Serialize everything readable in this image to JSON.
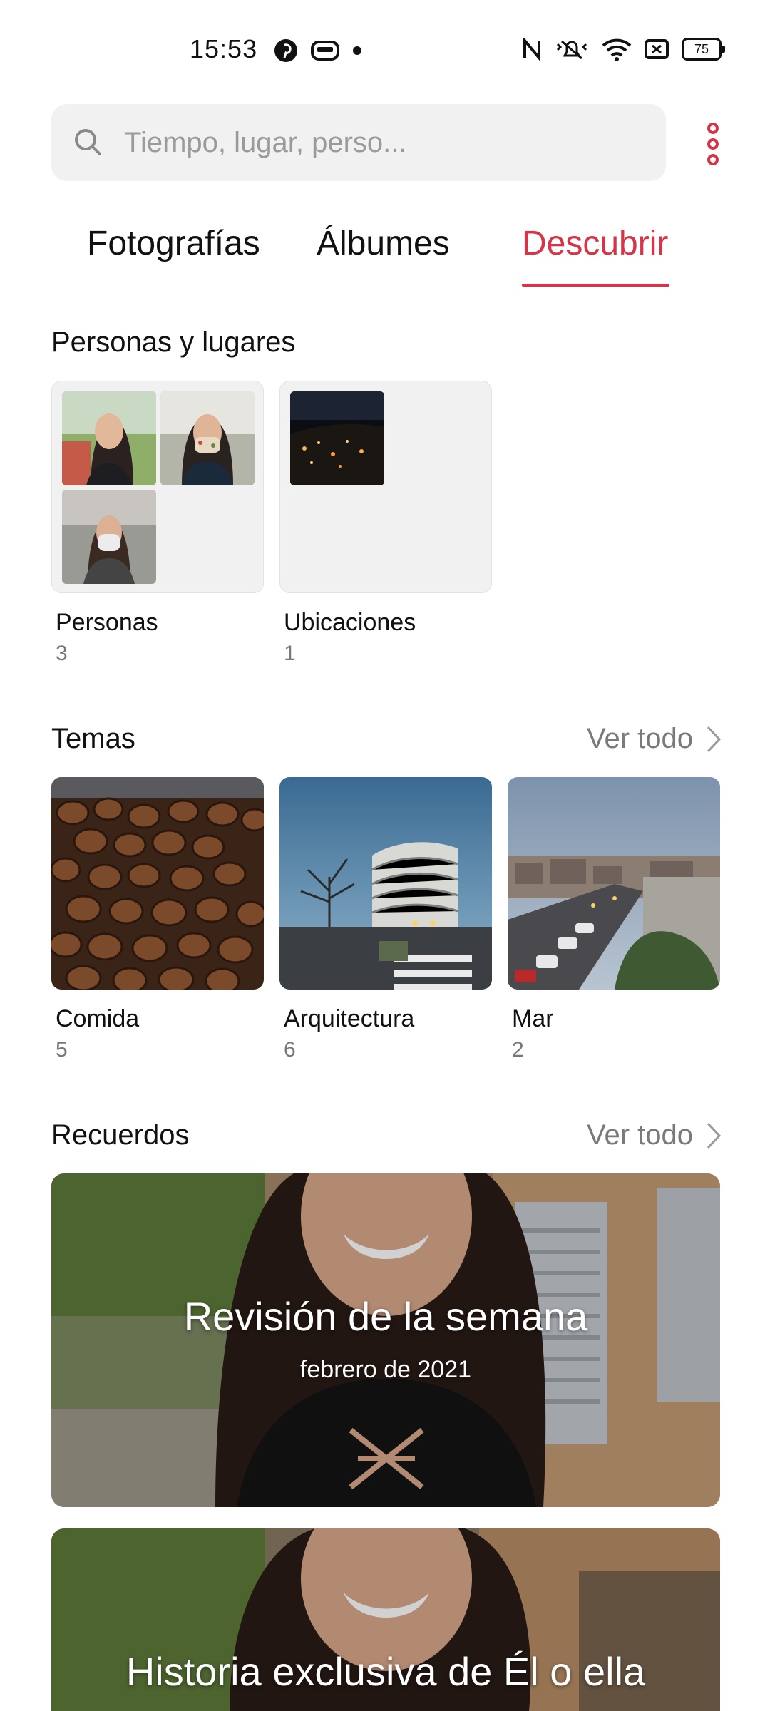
{
  "status_bar": {
    "time": "15:53",
    "battery_level": "75",
    "left_icons": [
      "pinterest-icon",
      "media-icon",
      "notification-dot-icon"
    ],
    "right_icons": [
      "nfc-icon",
      "vibrate-icon",
      "wifi-icon",
      "sim-icon",
      "battery-icon"
    ]
  },
  "search": {
    "placeholder": "Tiempo, lugar, perso..."
  },
  "tabs": [
    {
      "label": "Fotografías",
      "active": false
    },
    {
      "label": "Álbumes",
      "active": false
    },
    {
      "label": "Descubrir",
      "active": true
    }
  ],
  "people_places": {
    "title": "Personas y lugares",
    "items": [
      {
        "label": "Personas",
        "count": "3"
      },
      {
        "label": "Ubicaciones",
        "count": "1"
      }
    ]
  },
  "themes": {
    "title": "Temas",
    "see_all": "Ver todo",
    "items": [
      {
        "label": "Comida",
        "count": "5"
      },
      {
        "label": "Arquitectura",
        "count": "6"
      },
      {
        "label": "Mar",
        "count": "2"
      }
    ]
  },
  "memories": {
    "title": "Recuerdos",
    "see_all": "Ver todo",
    "items": [
      {
        "title": "Revisión de la semana",
        "subtitle": "febrero de 2021"
      },
      {
        "title": "Historia exclusiva de Él o ella",
        "subtitle": ""
      }
    ]
  },
  "colors": {
    "accent": "#d73448",
    "search_bg": "#f1f1f1",
    "muted_text": "#7a7a7a"
  }
}
